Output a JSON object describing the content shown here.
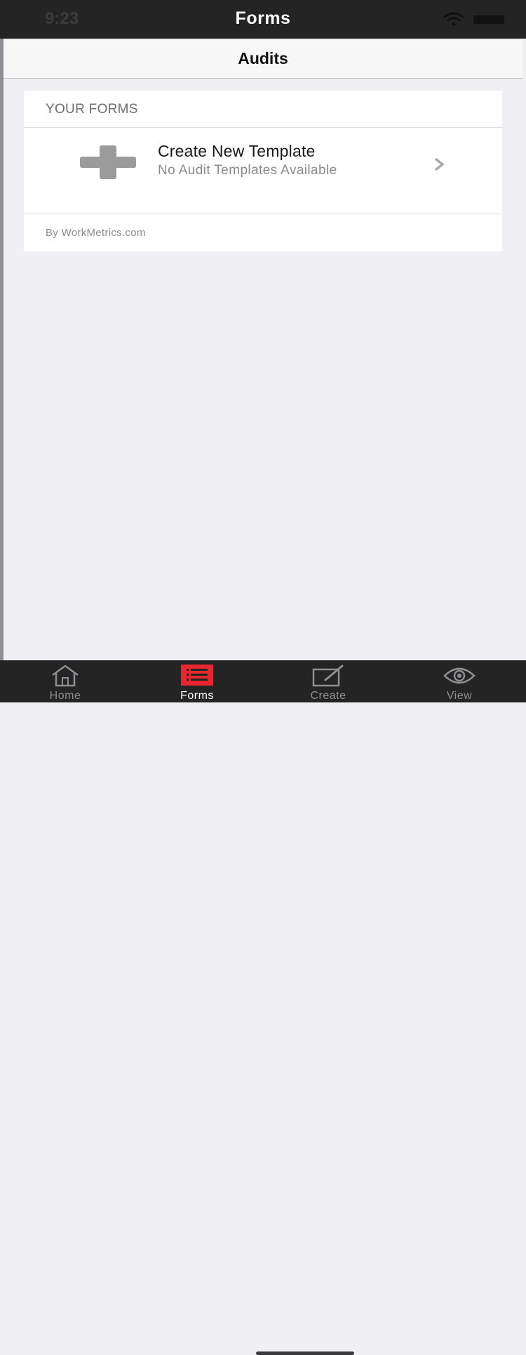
{
  "status_bar": {
    "time": "9:23",
    "title": "Forms"
  },
  "nav": {
    "title": "Audits"
  },
  "card": {
    "section_header": "YOUR FORMS",
    "row": {
      "title": "Create New Template",
      "subtitle": "No Audit Templates Available"
    },
    "footer": "By WorkMetrics.com"
  },
  "tabs": [
    {
      "label": "Home",
      "icon": "home-icon",
      "active": false
    },
    {
      "label": "Forms",
      "icon": "list-icon",
      "active": true
    },
    {
      "label": "Create",
      "icon": "edit-icon",
      "active": false
    },
    {
      "label": "View",
      "icon": "eye-icon",
      "active": false
    }
  ],
  "colors": {
    "bar_background": "#242424",
    "page_background": "#efeff4",
    "active_tab": "#e8262d",
    "icon_gray": "#9b9b9b"
  }
}
